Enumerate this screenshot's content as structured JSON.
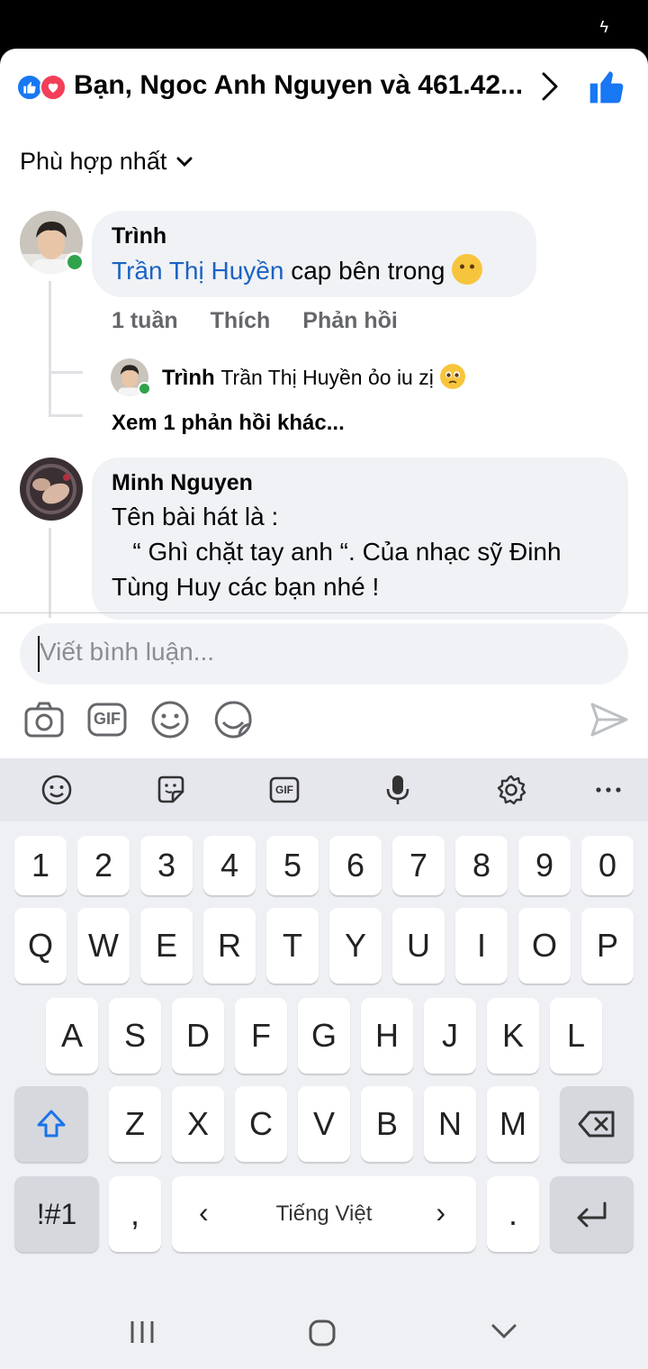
{
  "statusbar": {
    "icon": "charging-bolt-icon"
  },
  "reactions": {
    "summary": "Bạn, Ngoc Anh Nguyen và 461.42...",
    "icons": [
      "like-reaction-icon",
      "love-reaction-icon"
    ],
    "colors": {
      "like": "#1877f2",
      "love": "#f33e58"
    }
  },
  "sort": {
    "label": "Phù hợp nhất"
  },
  "comments": [
    {
      "author": "Trình",
      "mention": "Trần Thị Huyền",
      "text": " cap bên trong",
      "emoji": "neutral-face",
      "actions": {
        "time": "1 tuần",
        "like": "Thích",
        "reply": "Phản hồi"
      },
      "reply_preview": {
        "author": "Trình",
        "text": "Trần Thị Huyền ỏo iu zị",
        "emoji": "pleading-face"
      },
      "more_replies": "Xem 1 phản hồi khác..."
    },
    {
      "author": "Minh Nguyen",
      "lines": [
        "Tên bài hát là :",
        "   “ Ghì chặt tay anh “. Của nhạc sỹ Đinh",
        "Tùng Huy các bạn nhé !"
      ]
    }
  ],
  "composer": {
    "placeholder": "Viết bình luận...",
    "tools": [
      "camera-icon",
      "gif-icon",
      "emoji-icon",
      "sticker-icon"
    ],
    "send": "send-icon"
  },
  "keyboard": {
    "toolbar": [
      "emoji-icon",
      "sticker-icon",
      "gif-icon",
      "microphone-icon",
      "settings-icon",
      "more-icon"
    ],
    "gif_label": "GIF",
    "row_numbers": [
      "1",
      "2",
      "3",
      "4",
      "5",
      "6",
      "7",
      "8",
      "9",
      "0"
    ],
    "row1": [
      "Q",
      "W",
      "E",
      "R",
      "T",
      "Y",
      "U",
      "I",
      "O",
      "P"
    ],
    "row2": [
      "A",
      "S",
      "D",
      "F",
      "G",
      "H",
      "J",
      "K",
      "L"
    ],
    "row3": [
      "Z",
      "X",
      "C",
      "V",
      "B",
      "N",
      "M"
    ],
    "symbols": "!#1",
    "comma": ",",
    "period": ".",
    "space_label": "Tiếng Việt",
    "left": "‹",
    "right": "›"
  },
  "navbar": [
    "recent-apps-icon",
    "home-icon",
    "back-icon"
  ]
}
